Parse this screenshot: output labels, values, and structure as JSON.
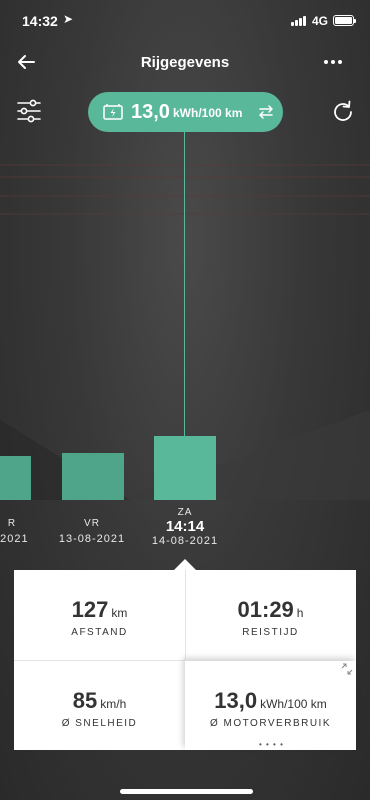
{
  "status_bar": {
    "time": "14:32",
    "network": "4G"
  },
  "nav": {
    "title": "Rijgegevens"
  },
  "metric": {
    "value": "13,0",
    "unit": "kWh/100 km"
  },
  "chart_data": {
    "type": "bar",
    "categories": [
      "VR 13-08-2021",
      "ZA 14-08-2021"
    ],
    "selected": "ZA 14-08-2021",
    "values": [
      13.0,
      13.0
    ]
  },
  "dates": {
    "prev_partial": {
      "day": "R",
      "date": "-2021"
    },
    "fri": {
      "day": "VR",
      "date": "13-08-2021"
    },
    "sat": {
      "day": "ZA",
      "time": "14:14",
      "date": "14-08-2021"
    }
  },
  "stats": {
    "distance": {
      "value": "127",
      "unit": "km",
      "label": "AFSTAND"
    },
    "travel_time": {
      "value": "01:29",
      "unit": "h",
      "label": "REISTIJD"
    },
    "speed": {
      "value": "85",
      "unit": "km/h",
      "label": "Ø SNELHEID"
    },
    "consumption": {
      "value": "13,0",
      "unit": "kWh/100 km",
      "label": "Ø MOTORVERBRUIK"
    }
  },
  "pager_dots": "• • • •",
  "colors": {
    "accent": "#5ab89a",
    "background": "#2f2f2f",
    "card": "#ffffff"
  }
}
